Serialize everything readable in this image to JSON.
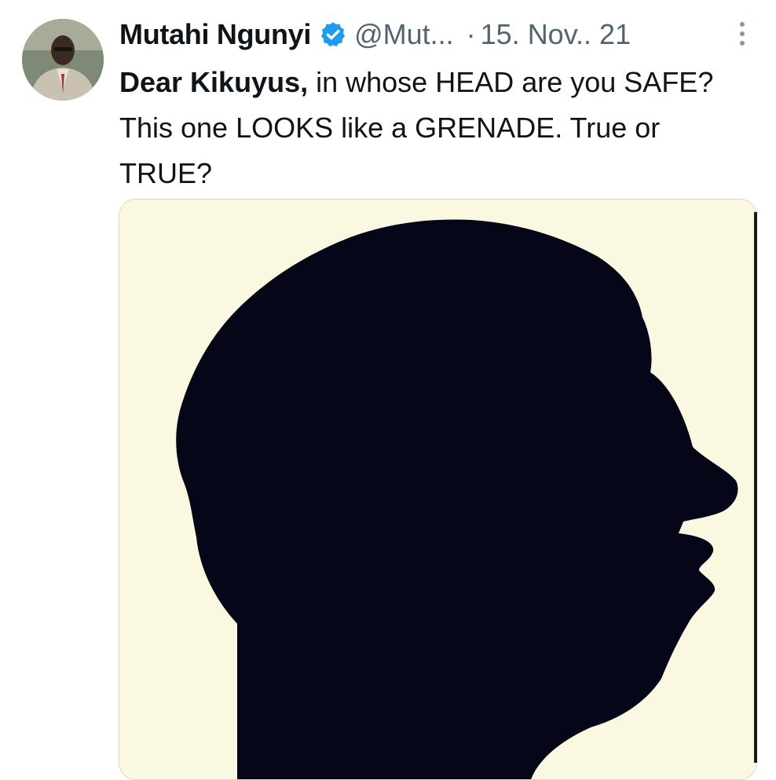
{
  "tweet": {
    "author": {
      "name": "Mutahi Ngunyi",
      "handle": "@Mut...",
      "verified": true
    },
    "separator": "·",
    "date": "15. Nov.. 21",
    "text": {
      "part1": "Dear Kikuyus,",
      "part2": " in whose HEAD are you SAFE? This one LOOKS like a GRENADE. True or TRUE?"
    },
    "icons": {
      "verified": "verified-badge-icon",
      "more": "more-vertical-icon"
    },
    "colors": {
      "verified_blue": "#1d9bf0",
      "secondary_text": "#536471",
      "image_background": "#fbf8e2",
      "silhouette": "#050718"
    }
  }
}
